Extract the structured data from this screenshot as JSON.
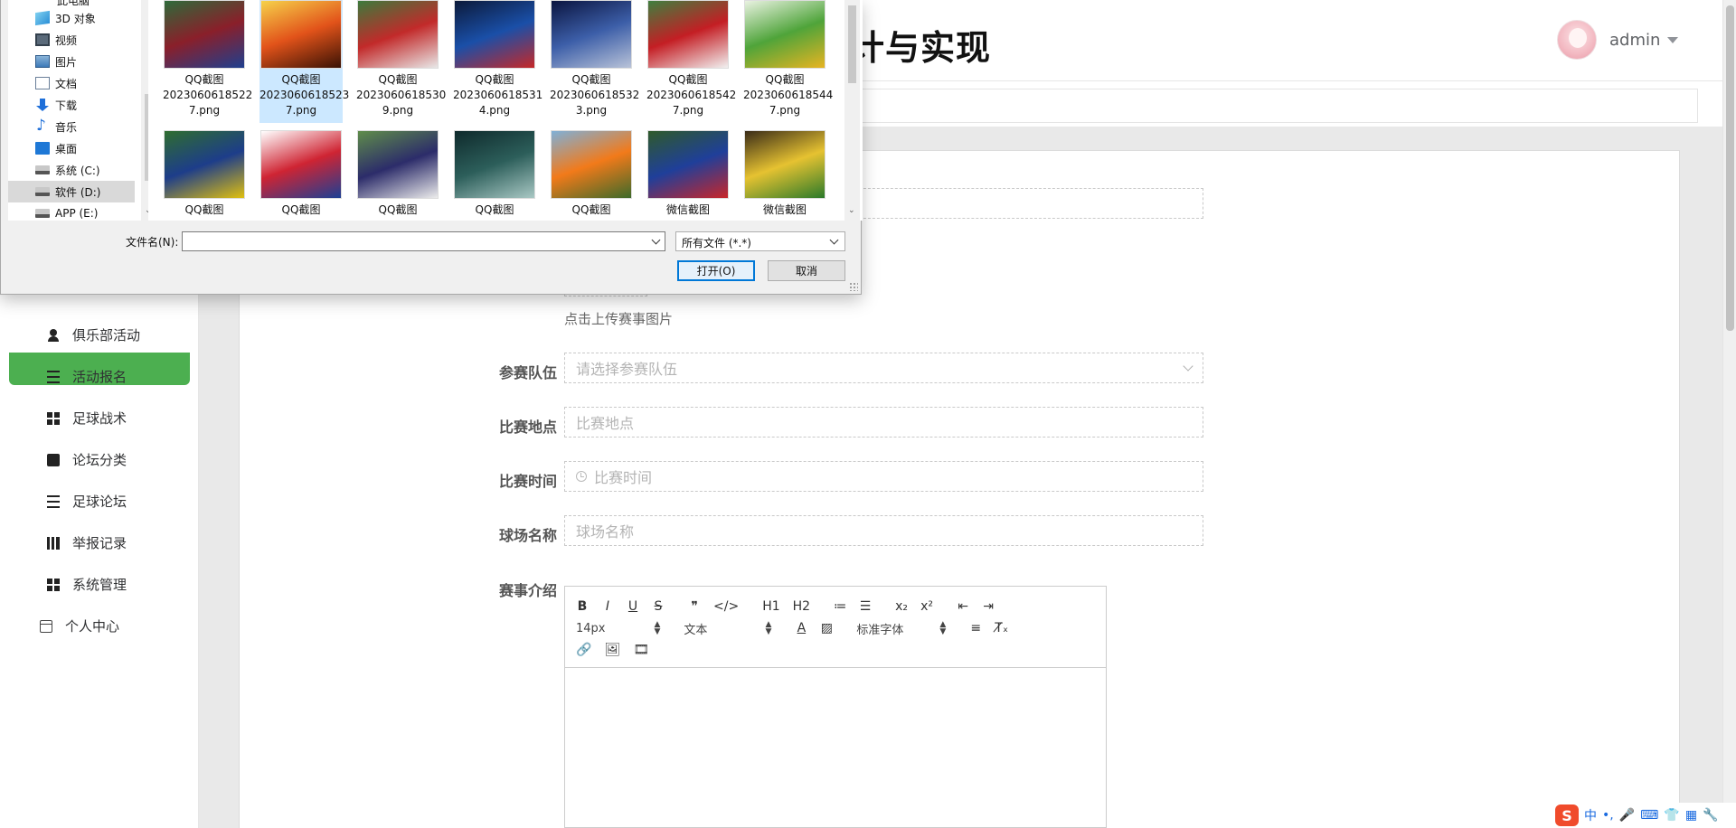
{
  "header": {
    "title_partial": "计与实现",
    "user_name": "admin"
  },
  "sidebar": {
    "items": [
      {
        "label": "俱乐部活动",
        "icon": "person-icon"
      },
      {
        "label": "活动报名",
        "icon": "list-icon"
      },
      {
        "label": "足球战术",
        "icon": "grid-icon"
      },
      {
        "label": "论坛分类",
        "icon": "chat-icon"
      },
      {
        "label": "足球论坛",
        "icon": "list-icon"
      },
      {
        "label": "举报记录",
        "icon": "book-icon"
      },
      {
        "label": "系统管理",
        "icon": "grid-icon"
      }
    ],
    "personal": "个人中心"
  },
  "form": {
    "upload_hint": "点击上传赛事图片",
    "teams_label": "参赛队伍",
    "teams_placeholder": "请选择参赛队伍",
    "location_label": "比赛地点",
    "location_placeholder": "比赛地点",
    "time_label": "比赛时间",
    "time_placeholder": "比赛时间",
    "stadium_label": "球场名称",
    "stadium_placeholder": "球场名称",
    "intro_label": "赛事介绍"
  },
  "editor": {
    "row1": [
      "B",
      "I",
      "U",
      "S",
      "❞",
      "</>",
      "H1",
      "H2",
      "≔",
      "☰",
      "x₂",
      "x²",
      "⇤",
      "⇥"
    ],
    "font_size": "14px",
    "text_type": "文本",
    "font_family": "标准字体",
    "row3_icons": [
      "link-icon",
      "image-icon",
      "video-icon"
    ]
  },
  "dialog": {
    "nav_top": "此电脑",
    "nav_items": [
      {
        "label": "3D 对象",
        "icon": "3d-objects-icon"
      },
      {
        "label": "视频",
        "icon": "video-folder-icon"
      },
      {
        "label": "图片",
        "icon": "pictures-folder-icon"
      },
      {
        "label": "文档",
        "icon": "documents-folder-icon"
      },
      {
        "label": "下载",
        "icon": "downloads-folder-icon"
      },
      {
        "label": "音乐",
        "icon": "music-folder-icon"
      },
      {
        "label": "桌面",
        "icon": "desktop-folder-icon"
      },
      {
        "label": "系统 (C:)",
        "icon": "drive-icon"
      },
      {
        "label": "软件 (D:)",
        "icon": "drive-icon"
      },
      {
        "label": "APP (E:)",
        "icon": "drive-icon"
      }
    ],
    "files_row1": [
      {
        "name1": "QQ截图",
        "name2": "2023060618522",
        "name3": "7.png",
        "colors": [
          "#2e6a3a",
          "#8a1f2a",
          "#1f3f8f"
        ]
      },
      {
        "name1": "QQ截图",
        "name2": "2023060618523",
        "name3": "7.png",
        "colors": [
          "#f6d24a",
          "#e2531a",
          "#3a1205"
        ]
      },
      {
        "name1": "QQ截图",
        "name2": "2023060618530",
        "name3": "9.png",
        "colors": [
          "#3c7a3c",
          "#c22a2a",
          "#e8e8e8"
        ]
      },
      {
        "name1": "QQ截图",
        "name2": "2023060618531",
        "name3": "4.png",
        "colors": [
          "#0c1a3a",
          "#1a4fa8",
          "#c62828"
        ]
      },
      {
        "name1": "QQ截图",
        "name2": "2023060618532",
        "name3": "3.png",
        "colors": [
          "#0b1540",
          "#3c5ea8",
          "#b9c3d8"
        ]
      },
      {
        "name1": "QQ截图",
        "name2": "2023060618542",
        "name3": "7.png",
        "colors": [
          "#3f7f3f",
          "#c41e24",
          "#f1f1f1"
        ]
      },
      {
        "name1": "QQ截图",
        "name2": "2023060618544",
        "name3": "7.png",
        "colors": [
          "#e9f2e1",
          "#4fa43a",
          "#e7b422"
        ]
      }
    ],
    "files_row2": [
      {
        "name1": "QQ截图",
        "colors": [
          "#2f6d2f",
          "#1d3d8a",
          "#e0c010"
        ]
      },
      {
        "name1": "QQ截图",
        "colors": [
          "#ffffff",
          "#cf2433",
          "#1c3f94"
        ]
      },
      {
        "name1": "QQ截图",
        "colors": [
          "#5f8d4a",
          "#2c2c6a",
          "#ececec"
        ]
      },
      {
        "name1": "QQ截图",
        "colors": [
          "#0f2a2c",
          "#2c5e5a",
          "#a9c8c4"
        ]
      },
      {
        "name1": "QQ截图",
        "colors": [
          "#7fb0d8",
          "#f27a1a",
          "#3d6a2a"
        ]
      },
      {
        "name1": "微信截图",
        "colors": [
          "#2f5a2a",
          "#1f3f9a",
          "#c8262a"
        ]
      },
      {
        "name1": "微信截图",
        "colors": [
          "#3a2c18",
          "#e6c231",
          "#2b7a2a"
        ]
      }
    ],
    "filename_label": "文件名(N):",
    "filename_value": "",
    "filetype": "所有文件 (*.*)",
    "open_button": "打开(O)",
    "cancel_button": "取消"
  },
  "tray": {
    "ime_logo": "S",
    "ime_lang": "中",
    "items": [
      "•,",
      "🎤",
      "⌨",
      "👕",
      "▦",
      "🔧"
    ]
  }
}
